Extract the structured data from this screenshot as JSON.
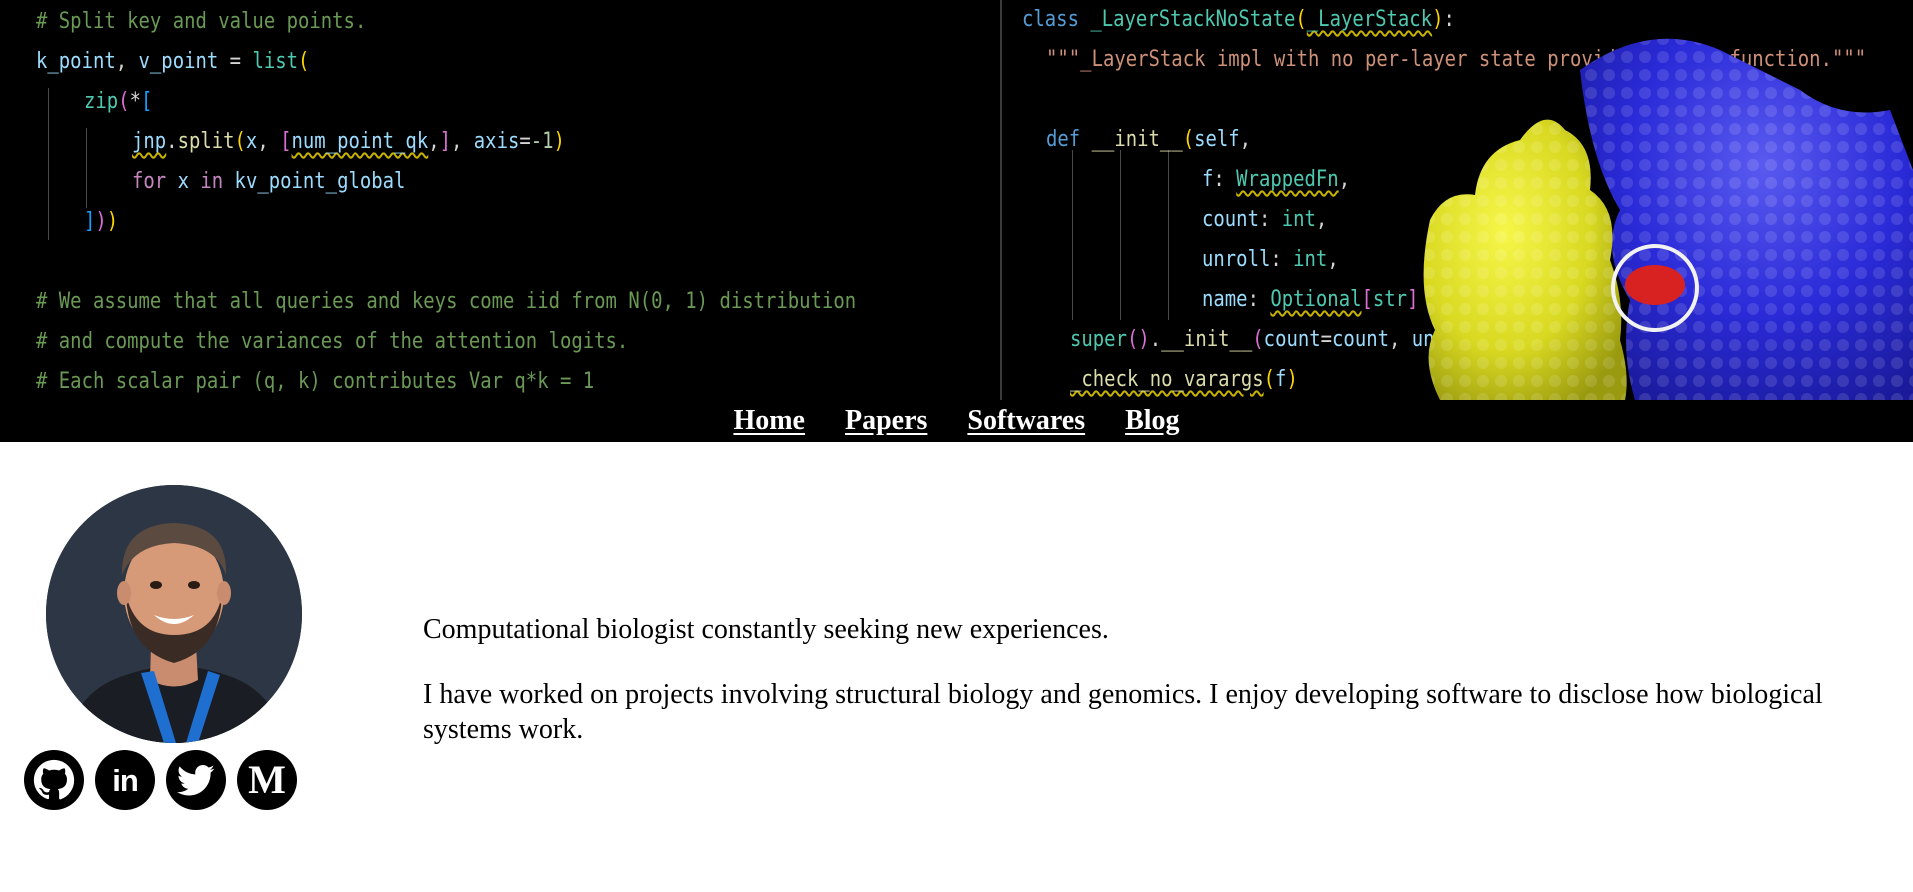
{
  "banner": {
    "code_left": [
      "# Split key and value points.",
      "k_point, v_point = list(",
      "zip(*[",
      "jnp.split(x, [num_point_qk,], axis=-1)",
      "for x in kv_point_global",
      "]))",
      "# We assume that all queries and keys come iid from N(0, 1) distribution",
      "# and compute the variances of the attention logits.",
      "# Each scalar pair (q, k) contributes Var q*k = 1"
    ],
    "code_right": [
      "class _LayerStackNoState(_LayerStack):",
      "\"\"\"_LayerStack impl with no per-layer state provided to the function.\"\"\"",
      "def __init__(self,",
      "f: WrappedFn,",
      "count: int,",
      "unroll: int,",
      "name: Optional[str]",
      "super().__init__(count=count, un",
      "_check_no_varargs(f)"
    ]
  },
  "nav": {
    "items": [
      {
        "label": "Home"
      },
      {
        "label": "Papers"
      },
      {
        "label": "Softwares"
      },
      {
        "label": "Blog"
      }
    ]
  },
  "profile": {
    "socials": [
      {
        "icon": "github-icon"
      },
      {
        "icon": "linkedin-icon",
        "glyph": "in"
      },
      {
        "icon": "twitter-icon"
      },
      {
        "icon": "medium-icon",
        "glyph": "M"
      }
    ]
  },
  "bio": {
    "paragraphs": [
      "Computational biologist constantly seeking new experiences.",
      "I have worked on projects involving structural biology and genomics. I enjoy developing software to disclose how biological systems work."
    ]
  },
  "colors": {
    "banner_bg": "#000000",
    "nav_text": "#ffffff",
    "protein_yellow": "#e6e62a",
    "protein_blue": "#3a3ae0",
    "avatar_bg": "#2c3644"
  }
}
